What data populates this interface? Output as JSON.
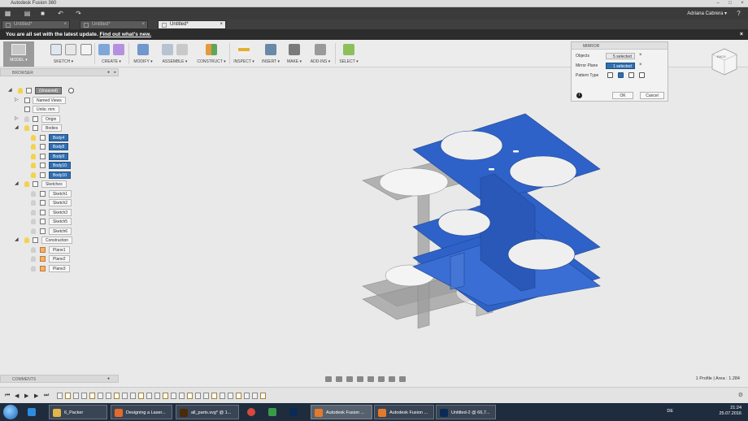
{
  "window": {
    "title": "Autodesk Fusion 360",
    "controls": [
      "–",
      "□",
      "×"
    ]
  },
  "quickbar": {
    "user": "Adriana Cabrera ▾",
    "help": "?"
  },
  "tabs": [
    {
      "label": "Untitled*",
      "active": false
    },
    {
      "label": "Untitled*",
      "active": false
    },
    {
      "label": "Untitled*",
      "active": true
    }
  ],
  "banner": {
    "text": "You are all set with the latest update.",
    "link": "Find out what's new.",
    "close": "×"
  },
  "toolbar": {
    "model": "MODEL ▾",
    "groups": [
      "SKETCH ▾",
      "CREATE ▾",
      "MODIFY ▾",
      "ASSEMBLE ▾",
      "CONSTRUCT ▾",
      "INSPECT ▾",
      "INSERT ▾",
      "MAKE ▾",
      "ADD-INS ▾",
      "SELECT ▾"
    ]
  },
  "browser": {
    "header": "BROWSER",
    "root": "(Unsaved)",
    "named_views": "Named Views",
    "units": "Units: mm",
    "origin": "Origin",
    "bodies": "Bodies",
    "body_items": [
      "Body4",
      "Body8",
      "Body9",
      "Body10",
      "Body10"
    ],
    "sketches": "Sketches",
    "sketch_items": [
      "Sketch1",
      "Sketch2",
      "Sketch3",
      "Sketch5",
      "Sketch6"
    ],
    "construction": "Construction",
    "plane_items": [
      "Plane1",
      "Plane2",
      "Plane3"
    ]
  },
  "comments": {
    "label": "COMMENTS"
  },
  "mirror": {
    "title": "MIRROR",
    "objects_label": "Objects",
    "objects_value": "5 selected",
    "plane_label": "Mirror Plane",
    "plane_value": "1 selected",
    "pattern_label": "Pattern Type",
    "ok": "OK",
    "cancel": "Cancel",
    "info": "i"
  },
  "viewcube": {
    "face": "BACK"
  },
  "status": {
    "text": "1 Profile | Area : 1.284"
  },
  "taskbar": {
    "items": [
      "6_Packer",
      "Designing a Laser...",
      "all_parts.svg* @ 1...",
      "Autodesk Fusion ...",
      "Autodesk Fusion ...",
      "Untitled-2 @ 66,7..."
    ],
    "lang": "DE",
    "time": "21:24",
    "date": "25.07.2016"
  },
  "colors": {
    "accent": "#2f6fb1",
    "body_blue": "#2f62c8",
    "ghost": "#a0a0a0",
    "banner": "#2c2c2c",
    "taskbar": "#1e2c3e"
  }
}
